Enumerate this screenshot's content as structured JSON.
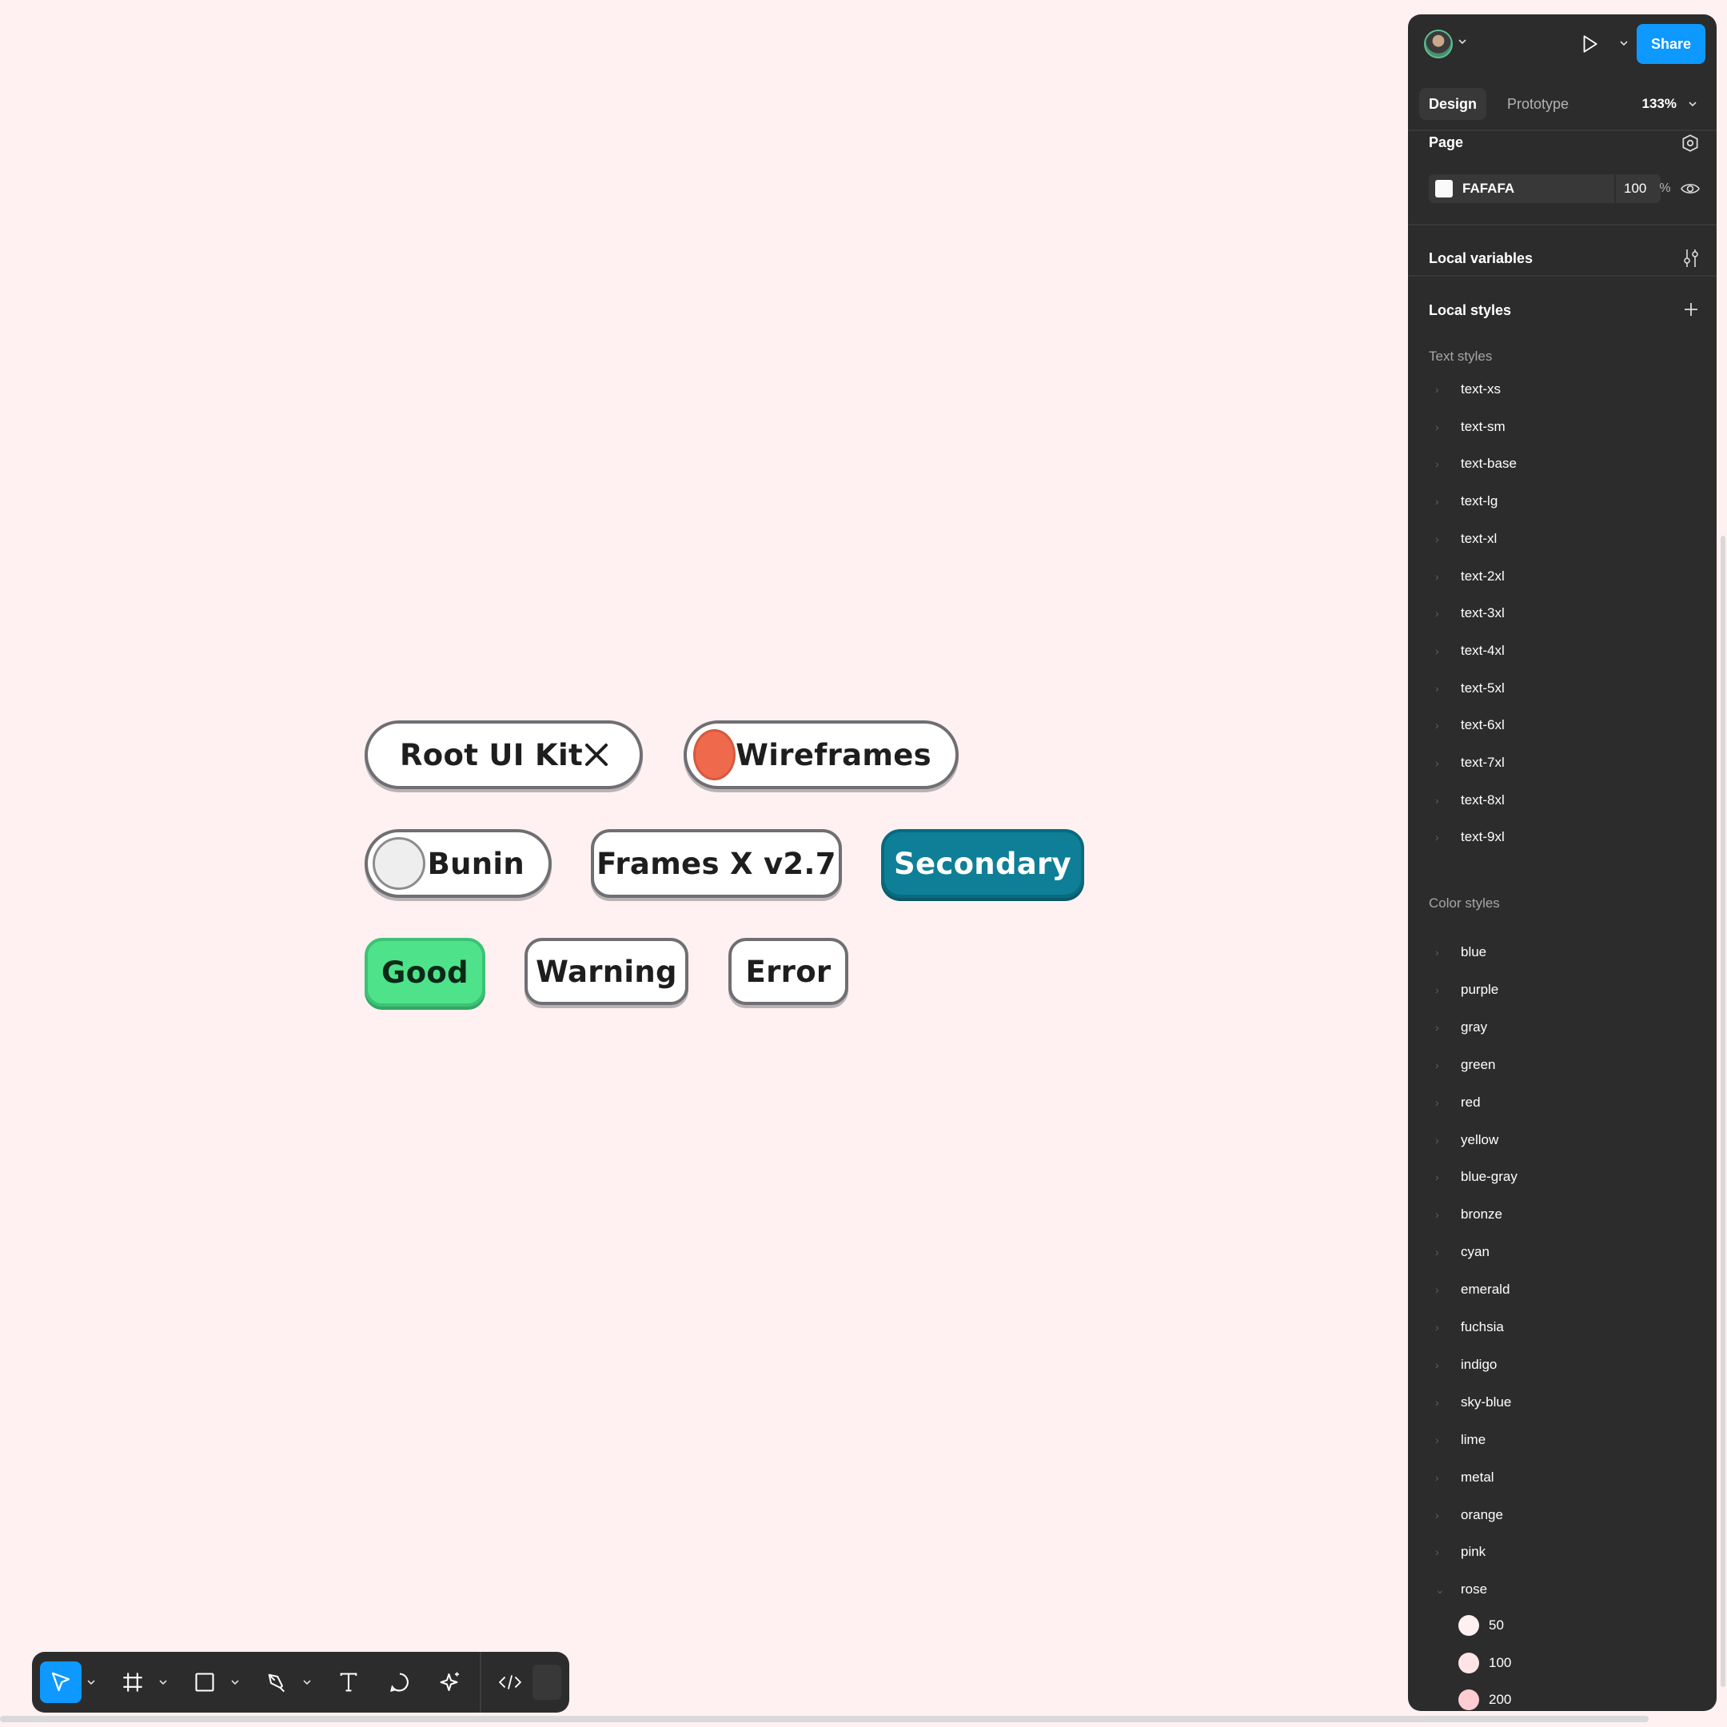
{
  "canvas": {
    "chips": {
      "root": {
        "label": "Root UI Kit"
      },
      "wireframes": {
        "label": "Wireframes"
      },
      "bunin": {
        "label": "Bunin"
      },
      "frames": {
        "label": "Frames X v2.7"
      },
      "secondary": {
        "label": "Secondary"
      },
      "good": {
        "label": "Good"
      },
      "warning": {
        "label": "Warning"
      },
      "error": {
        "label": "Error"
      }
    }
  },
  "toolbar": {
    "tools": [
      "move-tool",
      "frame-tool",
      "shape-tool",
      "pen-tool",
      "text-tool",
      "comment-tool",
      "actions-tool",
      "dev-mode-tool"
    ]
  },
  "panel": {
    "share_label": "Share",
    "tabs": {
      "design": "Design",
      "prototype": "Prototype"
    },
    "zoom": "133%",
    "page": {
      "title": "Page",
      "color_hex": "FAFAFA",
      "opacity": "100",
      "opacity_unit": "%"
    },
    "local_variables": "Local variables",
    "local_styles": "Local styles",
    "text_styles": {
      "title": "Text styles",
      "items": [
        "text-xs",
        "text-sm",
        "text-base",
        "text-lg",
        "text-xl",
        "text-2xl",
        "text-3xl",
        "text-4xl",
        "text-5xl",
        "text-6xl",
        "text-7xl",
        "text-8xl",
        "text-9xl"
      ]
    },
    "color_styles": {
      "title": "Color styles",
      "items": [
        "blue",
        "purple",
        "gray",
        "green",
        "red",
        "yellow",
        "blue-gray",
        "bronze",
        "cyan",
        "emerald",
        "fuchsia",
        "indigo",
        "sky-blue",
        "lime",
        "metal",
        "orange",
        "pink",
        "rose"
      ],
      "rose_shades": [
        {
          "label": "50",
          "color": "#fff1f2"
        },
        {
          "label": "100",
          "color": "#ffe4e6"
        },
        {
          "label": "200",
          "color": "#fecdd3"
        }
      ]
    }
  },
  "colors": {
    "accent": "#0d99ff",
    "secondary": "#0e7f96",
    "good": "#4ee38a",
    "warning": "#e8735a",
    "error": "#c2282c",
    "canvas_bg": "#fff1f2"
  }
}
